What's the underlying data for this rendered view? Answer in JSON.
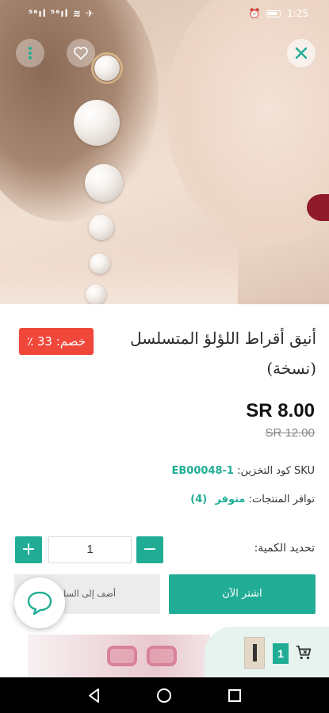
{
  "status_bar": {
    "left_icons": "⁵⁶ıl ⁵⁶ıl ≋ ✈",
    "time": "1:25"
  },
  "header": {
    "more_icon": "more-vertical-icon",
    "favorite_icon": "heart-outline-icon",
    "close_icon": "close-icon"
  },
  "product": {
    "title": "أنيق أقراط اللؤلؤ المتسلسل (نسخة)",
    "discount_badge": "خصم: 33 ٪",
    "price": "SR 8.00",
    "old_price": "SR 12.00",
    "sku_label": "SKU كود التخزين:",
    "sku_value": "EB00048-1",
    "availability_label": "توافر المنتجات:",
    "availability_value": "متوفر",
    "availability_count": "(4)"
  },
  "quantity": {
    "label": "تحديد الكمية:",
    "value": "1",
    "plus": "+",
    "minus": "−"
  },
  "actions": {
    "buy_now": "اشتر الآن",
    "add_to_cart": "أضف إلى السلة"
  },
  "cart_widget": {
    "count": "1"
  },
  "colors": {
    "accent": "#21ad95",
    "discount": "#f0473b"
  }
}
